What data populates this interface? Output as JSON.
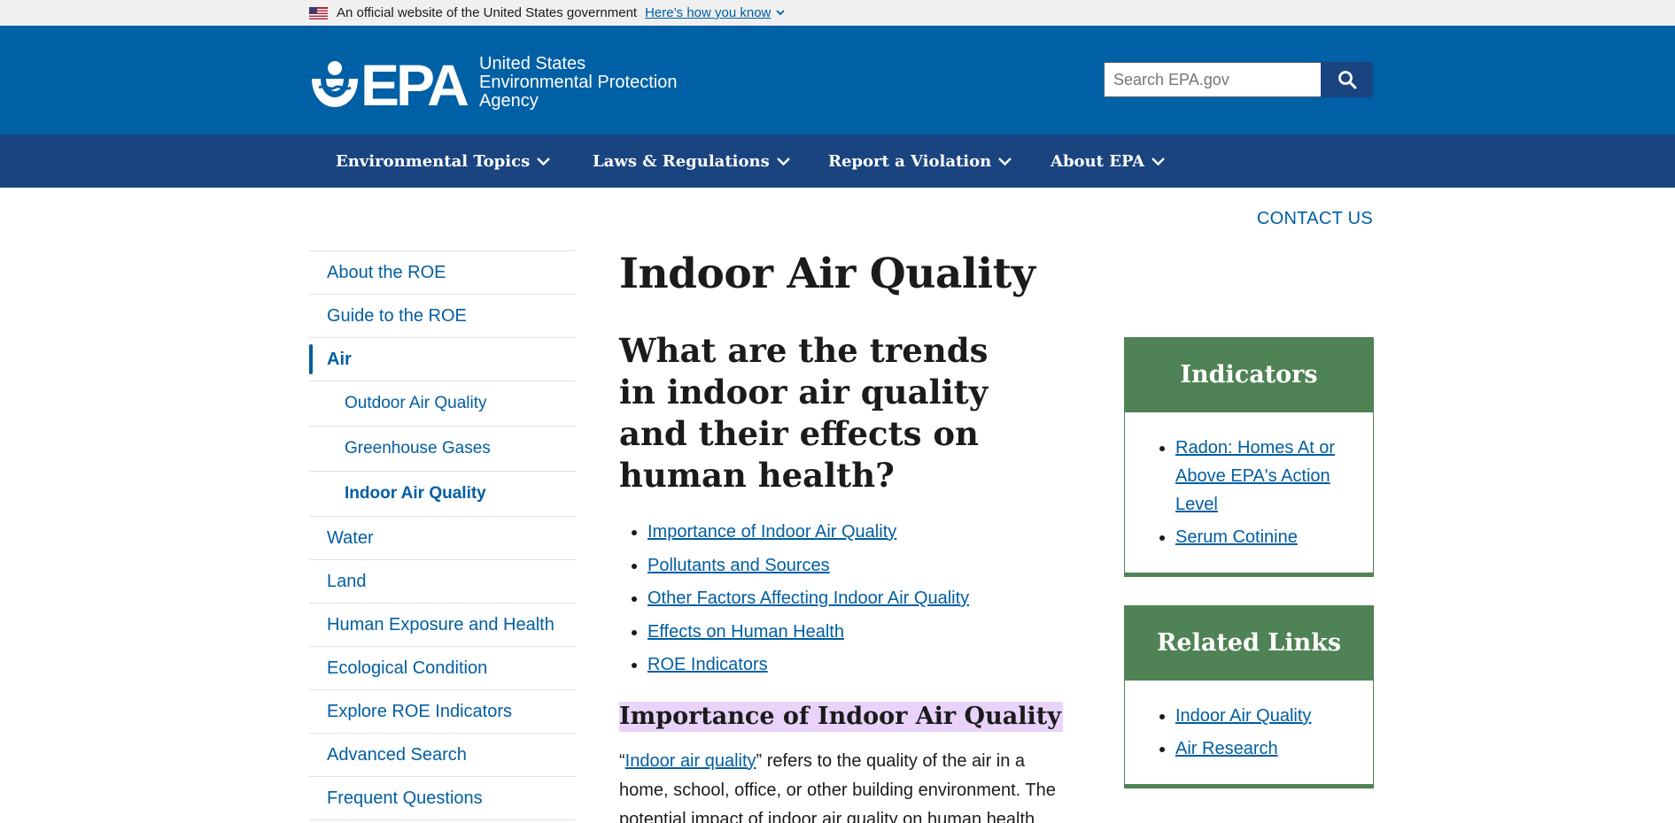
{
  "banner": {
    "text": "An official website of the United States government",
    "link": "Here’s how you know"
  },
  "header": {
    "logo_lines": [
      "United States",
      "Environmental Protection",
      "Agency"
    ],
    "logo_letters": "EPA",
    "search_placeholder": "Search EPA.gov"
  },
  "nav": {
    "items": [
      {
        "label": "Environmental Topics"
      },
      {
        "label": "Laws & Regulations"
      },
      {
        "label": "Report a Violation"
      },
      {
        "label": "About EPA"
      }
    ]
  },
  "contact": "CONTACT US",
  "sidenav": {
    "items": [
      {
        "label": "About the ROE"
      },
      {
        "label": "Guide to the ROE"
      },
      {
        "label": "Air"
      },
      {
        "label": "Outdoor Air Quality"
      },
      {
        "label": "Greenhouse Gases"
      },
      {
        "label": "Indoor Air Quality"
      },
      {
        "label": "Water"
      },
      {
        "label": "Land"
      },
      {
        "label": "Human Exposure and Health"
      },
      {
        "label": "Ecological Condition"
      },
      {
        "label": "Explore ROE Indicators"
      },
      {
        "label": "Advanced Search"
      },
      {
        "label": "Frequent Questions"
      }
    ]
  },
  "main": {
    "title": "Indoor Air Quality",
    "question": "What are the trends in indoor air quality and their effects on human health?",
    "toc": [
      "Importance of Indoor Air Quality",
      "Pollutants and Sources",
      "Other Factors Affecting Indoor Air Quality",
      "Effects on Human Health",
      "ROE Indicators"
    ],
    "section_heading": "Importance of Indoor Air Quality",
    "para_open_quote": "“",
    "para_link": "Indoor air quality",
    "para_rest": "” refers to the quality of the air in a home, school, office, or other building environment. The potential impact of indoor air quality on human health"
  },
  "indicators_box": {
    "title": "Indicators",
    "links": [
      "Radon: Homes At or Above EPA's Action Level",
      "Serum Cotinine"
    ]
  },
  "related_box": {
    "title": "Related Links",
    "links": [
      "Indoor Air Quality",
      "Air Research"
    ]
  },
  "colors": {
    "header_blue": "#0060a6",
    "nav_blue": "#1a4480",
    "link_blue": "#005ea2",
    "box_green": "#4f8255",
    "highlight_purple": "#e9d3fb"
  }
}
